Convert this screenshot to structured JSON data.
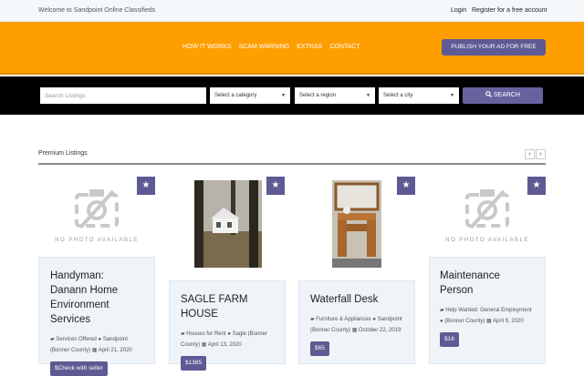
{
  "topbar": {
    "welcome": "Welcome to Sandpoint Online Classifieds",
    "login": "Login",
    "register": "Register for a free account"
  },
  "nav": {
    "items": [
      "HOW IT WORKS",
      "SCAM WARNING",
      "EXTRAS",
      "CONTACT"
    ],
    "publish": "PUBLISH YOUR AD FOR FREE"
  },
  "search": {
    "placeholder": "Search Listings",
    "category": "Select a category",
    "region": "Select a region",
    "city": "Select a city",
    "button": "SEARCH"
  },
  "premium": {
    "title": "Premium Listings",
    "prev": "‹",
    "next": "›"
  },
  "listings": [
    {
      "title": "Handyman: Danann Home Environment Services",
      "category": "Services Offered",
      "location": "Sandpoint (Bonner County)",
      "date": "April 21, 2020",
      "price": "$Check with seller",
      "photo": "NO PHOTO AVAILABLE"
    },
    {
      "title": "SAGLE FARM HOUSE",
      "category": "Houses for Rent",
      "location": "Sagle (Bonner County)",
      "date": "April 13, 2020",
      "price": "$1385"
    },
    {
      "title": "Waterfall Desk",
      "category": "Furniture & Appliances",
      "location": "Sandpoint (Bonner County)",
      "date": "October 22, 2019",
      "price": "$65"
    },
    {
      "title": "Maintenance Person",
      "category": "Help Wanted: General Employment",
      "location": "(Bonner County)",
      "date": "April 9, 2020",
      "price": "$16",
      "photo": "NO PHOTO AVAILABLE"
    }
  ],
  "colors": {
    "header": "#ff9e00",
    "accent": "#5e5a93",
    "searchbar": "#000000"
  }
}
